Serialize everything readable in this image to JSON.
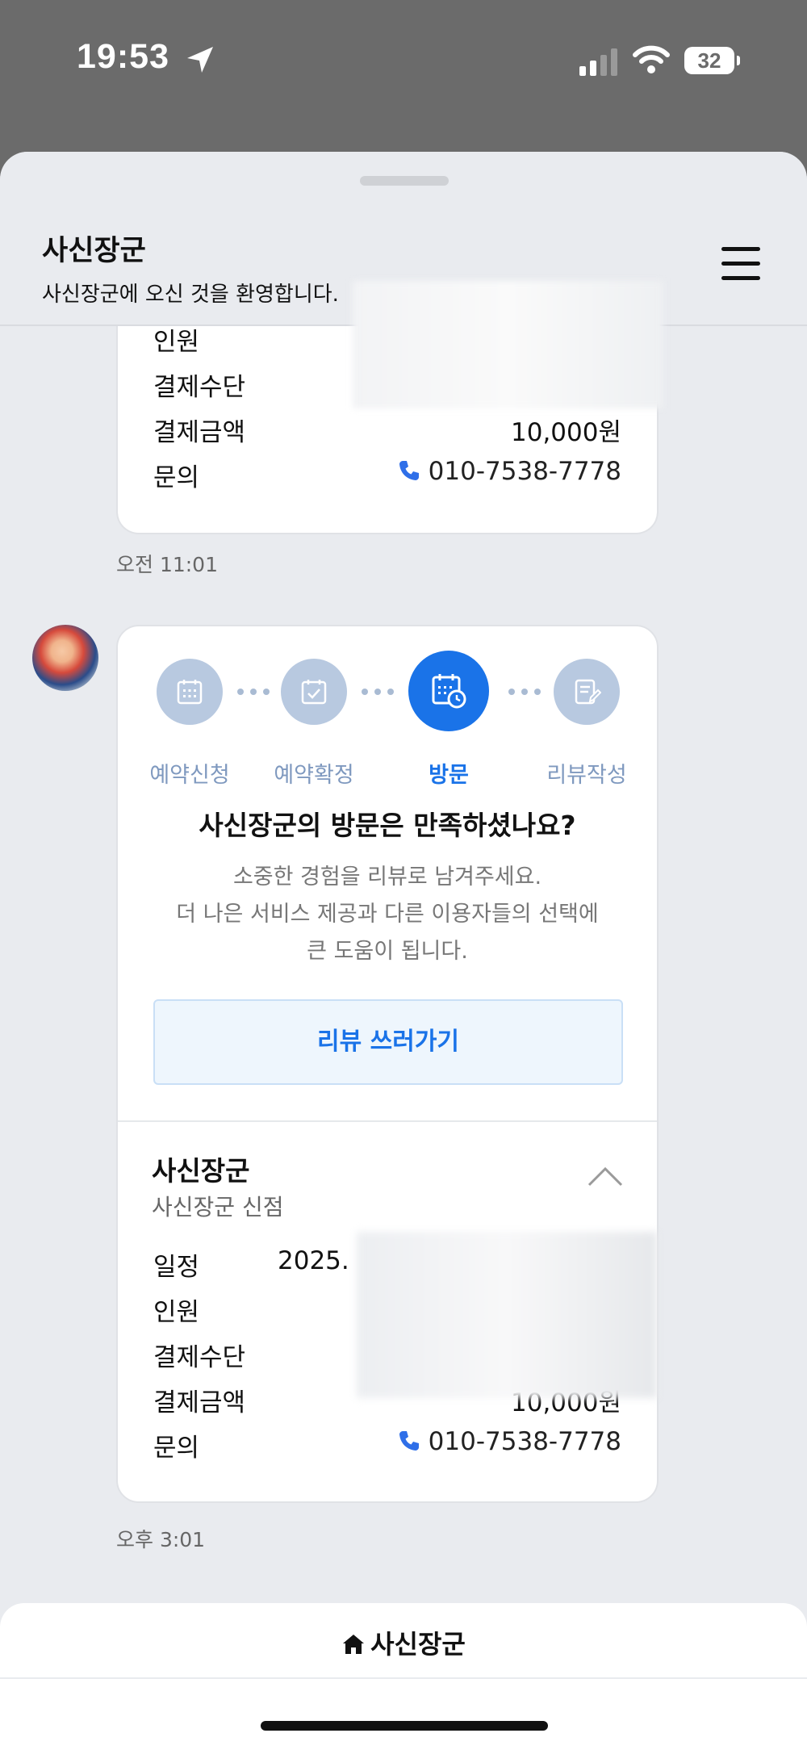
{
  "status_bar": {
    "time": "19:53",
    "battery": "32"
  },
  "header": {
    "title": "사신장군",
    "subtitle": "사신장군에 오신 것을 환영합니다."
  },
  "card1": {
    "rows": [
      {
        "label": "인원",
        "value": ""
      },
      {
        "label": "결제수단",
        "value": ""
      },
      {
        "label": "결제금액",
        "value": "10,000원"
      },
      {
        "label": "문의",
        "value": "010-7538-7778"
      }
    ]
  },
  "time1": "오전 11:01",
  "steps": [
    {
      "label": "예약신청",
      "icon": "calendar-grid-icon",
      "active": false
    },
    {
      "label": "예약확정",
      "icon": "calendar-check-icon",
      "active": false
    },
    {
      "label": "방문",
      "icon": "calendar-clock-icon",
      "active": true
    },
    {
      "label": "리뷰작성",
      "icon": "edit-note-icon",
      "active": false
    }
  ],
  "review": {
    "title": "사신장군의 방문은 만족하셨나요?",
    "desc1": "소중한 경험을 리뷰로 남겨주세요.",
    "desc2": "더 나은 서비스 제공과 다른 이용자들의 선택에",
    "desc3": "큰 도움이 됩니다.",
    "button": "리뷰 쓰러가기"
  },
  "card2": {
    "shop_name": "사신장군",
    "branch": "사신장군 신점",
    "rows": [
      {
        "label": "일정",
        "value": "2025."
      },
      {
        "label": "인원",
        "value": ""
      },
      {
        "label": "결제수단",
        "value": ""
      },
      {
        "label": "결제금액",
        "value": "10,000원"
      },
      {
        "label": "문의",
        "value": "010-7538-7778"
      }
    ]
  },
  "time2": "오후 3:01",
  "bottom": {
    "home_label": "사신장군"
  },
  "colors": {
    "accent": "#1a73e8",
    "step_inactive": "#b8c9e0",
    "sheet_bg": "#e9ebef"
  }
}
